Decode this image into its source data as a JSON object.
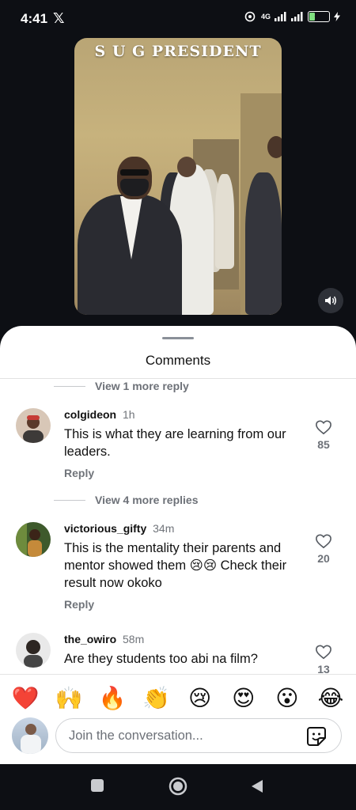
{
  "status_bar": {
    "time": "4:41",
    "x_glyph": "𝕏",
    "network": "4G",
    "battery": "31",
    "battery_level": 0.31
  },
  "video": {
    "overlay_title": "S U G PRESIDENT",
    "speaker_icon": "speaker-icon"
  },
  "sheet": {
    "title": "Comments"
  },
  "view_more": [
    {
      "label": "View 1 more reply"
    },
    {
      "label": "View 4 more replies"
    }
  ],
  "comments": [
    {
      "username": "colgideon",
      "time": "1h",
      "text": "This is what they are learning from our leaders.",
      "reply_label": "Reply",
      "likes": "85"
    },
    {
      "username": "victorious_gifty",
      "time": "34m",
      "text": "This is the mentality their parents and mentor showed them 😢😢 Check their result now okoko",
      "reply_label": "Reply",
      "likes": "20"
    },
    {
      "username": "the_owiro",
      "time": "58m",
      "text": "Are they students too abi na film?",
      "reply_label": "",
      "likes": "13"
    }
  ],
  "reactions": [
    "❤️",
    "🙌",
    "🔥",
    "👏",
    "😢",
    "😍",
    "😮",
    "😂"
  ],
  "input": {
    "placeholder": "Join the conversation..."
  },
  "colors": {
    "background": "#0d0f14",
    "sheet": "#ffffff",
    "muted_text": "#6d7178",
    "battery_fill": "#7fe07f"
  }
}
